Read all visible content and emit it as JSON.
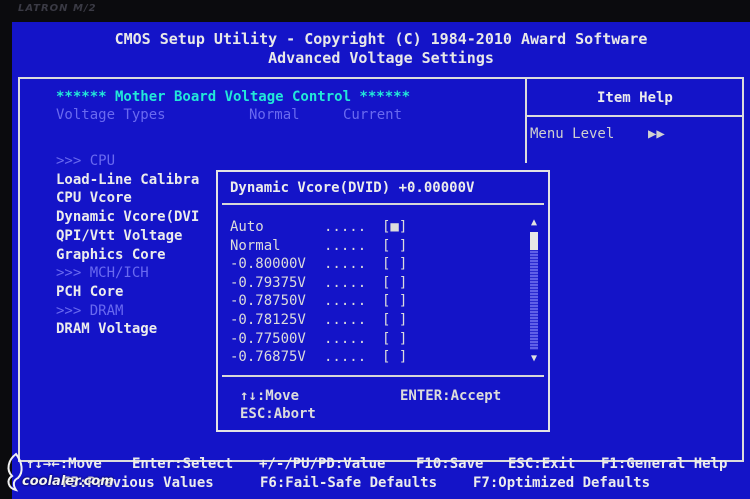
{
  "bezel_brand": "LATRON M/2",
  "header": {
    "line1": "CMOS Setup Utility - Copyright (C) 1984-2010 Award Software",
    "line2": "Advanced Voltage Settings"
  },
  "main": {
    "section_title": "****** Mother Board Voltage Control ******",
    "col_headers": {
      "types": "Voltage Types",
      "normal": "Normal",
      "current": "Current"
    },
    "items": [
      {
        "label": ">>> CPU",
        "dim": true
      },
      {
        "label": "Load-Line Calibra",
        "dim": false
      },
      {
        "label": "CPU Vcore",
        "dim": false
      },
      {
        "label": "Dynamic Vcore(DVI",
        "dim": false
      },
      {
        "label": "QPI/Vtt Voltage",
        "dim": false
      },
      {
        "label": "Graphics Core",
        "dim": false
      },
      {
        "label": ">>> MCH/ICH",
        "dim": true
      },
      {
        "label": "PCH Core",
        "dim": false
      },
      {
        "label": ">>> DRAM",
        "dim": true
      },
      {
        "label": "DRAM Voltage",
        "dim": false
      }
    ]
  },
  "help": {
    "title": "Item Help",
    "menu_level_label": "Menu Level",
    "menu_level_value": "▶▶"
  },
  "popup": {
    "title": "Dynamic Vcore(DVID) +0.00000V",
    "options": [
      {
        "label": "Auto",
        "dots": ".....",
        "box": "[■]",
        "selected": true
      },
      {
        "label": "Normal",
        "dots": ".....",
        "box": "[ ]",
        "selected": false
      },
      {
        "label": "-0.80000V",
        "dots": ".....",
        "box": "[ ]",
        "selected": false
      },
      {
        "label": "-0.79375V",
        "dots": ".....",
        "box": "[ ]",
        "selected": false
      },
      {
        "label": "-0.78750V",
        "dots": ".....",
        "box": "[ ]",
        "selected": false
      },
      {
        "label": "-0.78125V",
        "dots": ".....",
        "box": "[ ]",
        "selected": false
      },
      {
        "label": "-0.77500V",
        "dots": ".....",
        "box": "[ ]",
        "selected": false
      },
      {
        "label": "-0.76875V",
        "dots": ".....",
        "box": "[ ]",
        "selected": false
      }
    ],
    "scroll_up": "▲",
    "scroll_down": "▼",
    "footer": {
      "move": "↑↓:Move",
      "accept": "ENTER:Accept",
      "abort": "ESC:Abort"
    }
  },
  "footer": {
    "line1": [
      {
        "key": "move",
        "text": "↑↓→←:Move"
      },
      {
        "key": "select",
        "text": "Enter:Select"
      },
      {
        "key": "value",
        "text": "+/-/PU/PD:Value"
      },
      {
        "key": "save",
        "text": "F10:Save"
      },
      {
        "key": "exit",
        "text": "ESC:Exit"
      },
      {
        "key": "help",
        "text": "F1:General Help"
      }
    ],
    "line2": [
      {
        "key": "previous",
        "text": "F5:Previous Values"
      },
      {
        "key": "failsafe",
        "text": "F6:Fail-Safe Defaults"
      },
      {
        "key": "optimized",
        "text": "F7:Optimized Defaults"
      }
    ]
  },
  "watermark": "coolaler.com",
  "colors": {
    "background": "#1414c8",
    "text": "#ececec",
    "highlight": "#22e8d8",
    "disabled": "#6a6af0",
    "border": "#dcdcdc"
  }
}
